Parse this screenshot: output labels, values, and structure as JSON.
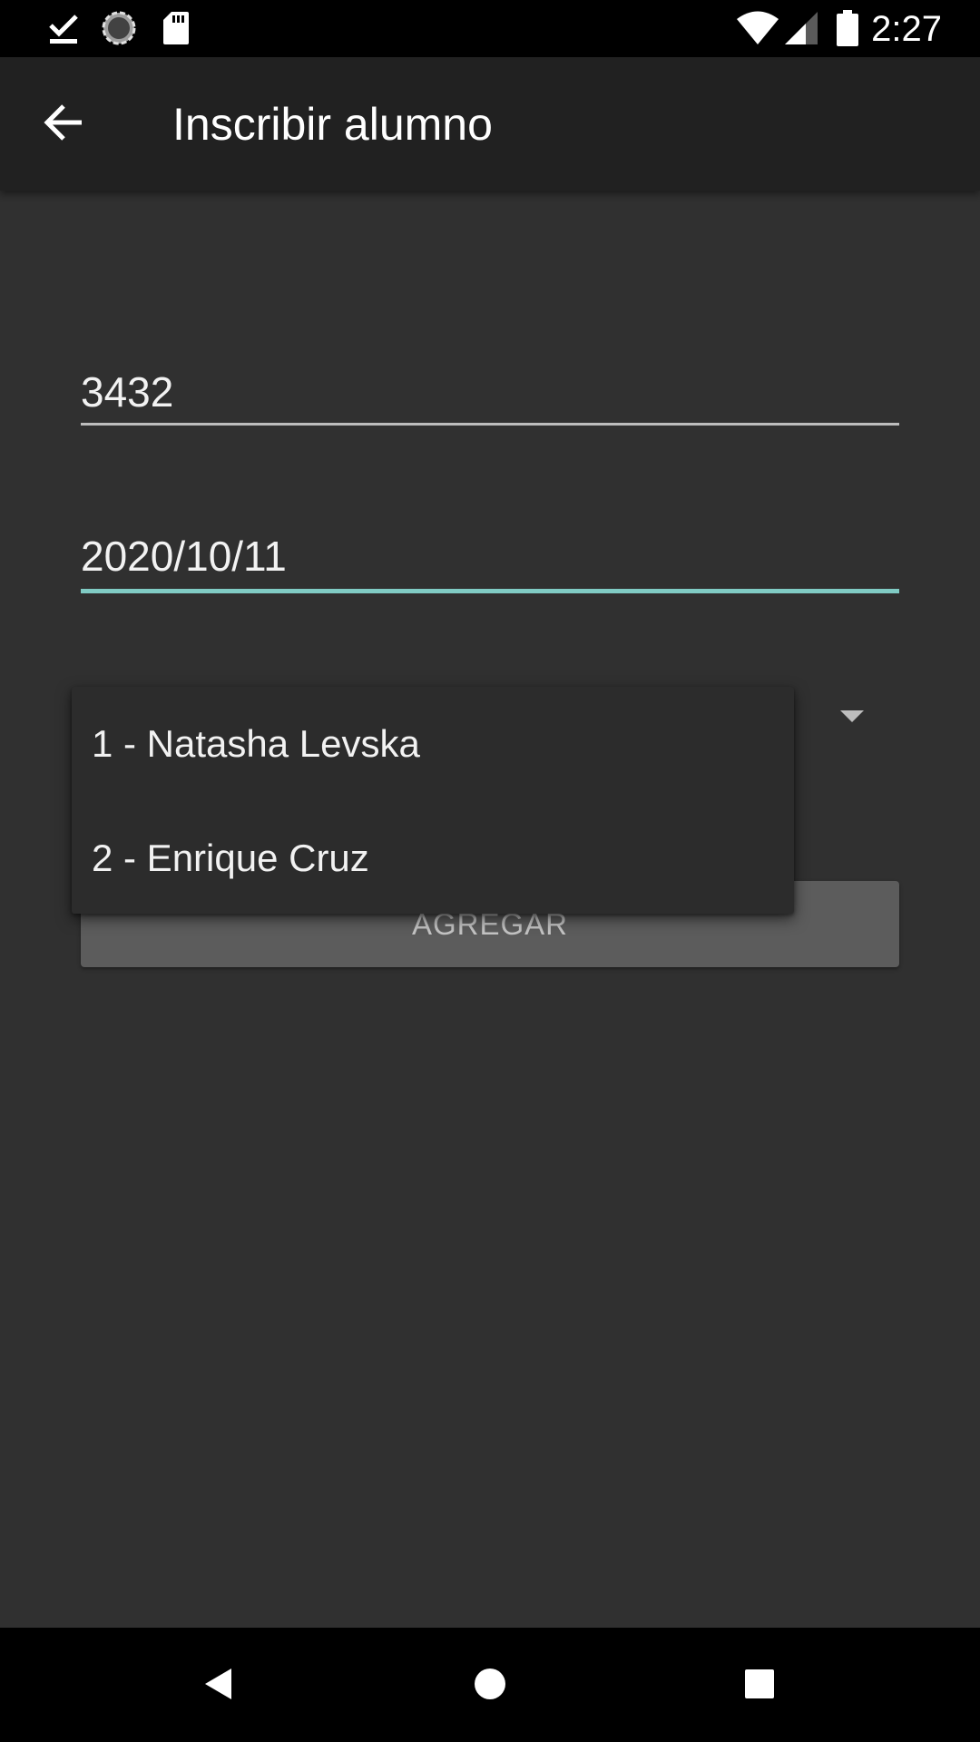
{
  "status_bar": {
    "time": "2:27",
    "icons": [
      "download-done-icon",
      "sync-icon",
      "sd-card-icon",
      "wifi-icon",
      "signal-icon",
      "battery-icon"
    ]
  },
  "app_bar": {
    "title": "Inscribir alumno",
    "back_icon": "arrow-back-icon"
  },
  "form": {
    "id_value": "3432",
    "date_value": "2020/10/11",
    "add_button_label": "AGREGAR"
  },
  "dropdown": {
    "items": [
      {
        "label": "1 - Natasha Levska"
      },
      {
        "label": "2 - Enrique Cruz"
      }
    ]
  },
  "nav_bar": {
    "icons": [
      "back-triangle-icon",
      "home-circle-icon",
      "recents-square-icon"
    ]
  },
  "colors": {
    "background": "#303030",
    "app_bar": "#212121",
    "accent": "#80cbc4",
    "button": "#5c5c5c"
  }
}
